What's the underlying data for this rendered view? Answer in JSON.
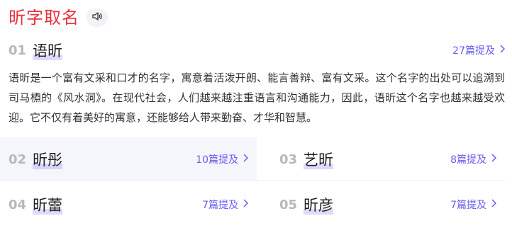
{
  "header": {
    "title": "昕字取名",
    "audio_icon": "speaker-icon"
  },
  "items": [
    {
      "num": "01",
      "name": "语昕",
      "mentions": "27篇提及"
    },
    {
      "num": "02",
      "name": "昕彤",
      "mentions": "10篇提及"
    },
    {
      "num": "03",
      "name": "艺昕",
      "mentions": "8篇提及"
    },
    {
      "num": "04",
      "name": "昕蕾",
      "mentions": "7篇提及"
    },
    {
      "num": "05",
      "name": "昕彦",
      "mentions": "7篇提及"
    }
  ],
  "description": "语昕是一个富有文采和口才的名字，寓意着活泼开朗、能言善辩、富有文采。这个名字的出处可以追溯到司马槱的《风水洞》。在现代社会，人们越来越注重语言和沟通能力，因此，语昕这个名字也越来越受欢迎。它不仅有着美好的寓意，还能够给人带来勤奋、才华和智慧。",
  "colors": {
    "title": "#e8313a",
    "accent": "#6a5cf0",
    "number": "#b6b8c0",
    "highlight": "#f5f6fb"
  }
}
